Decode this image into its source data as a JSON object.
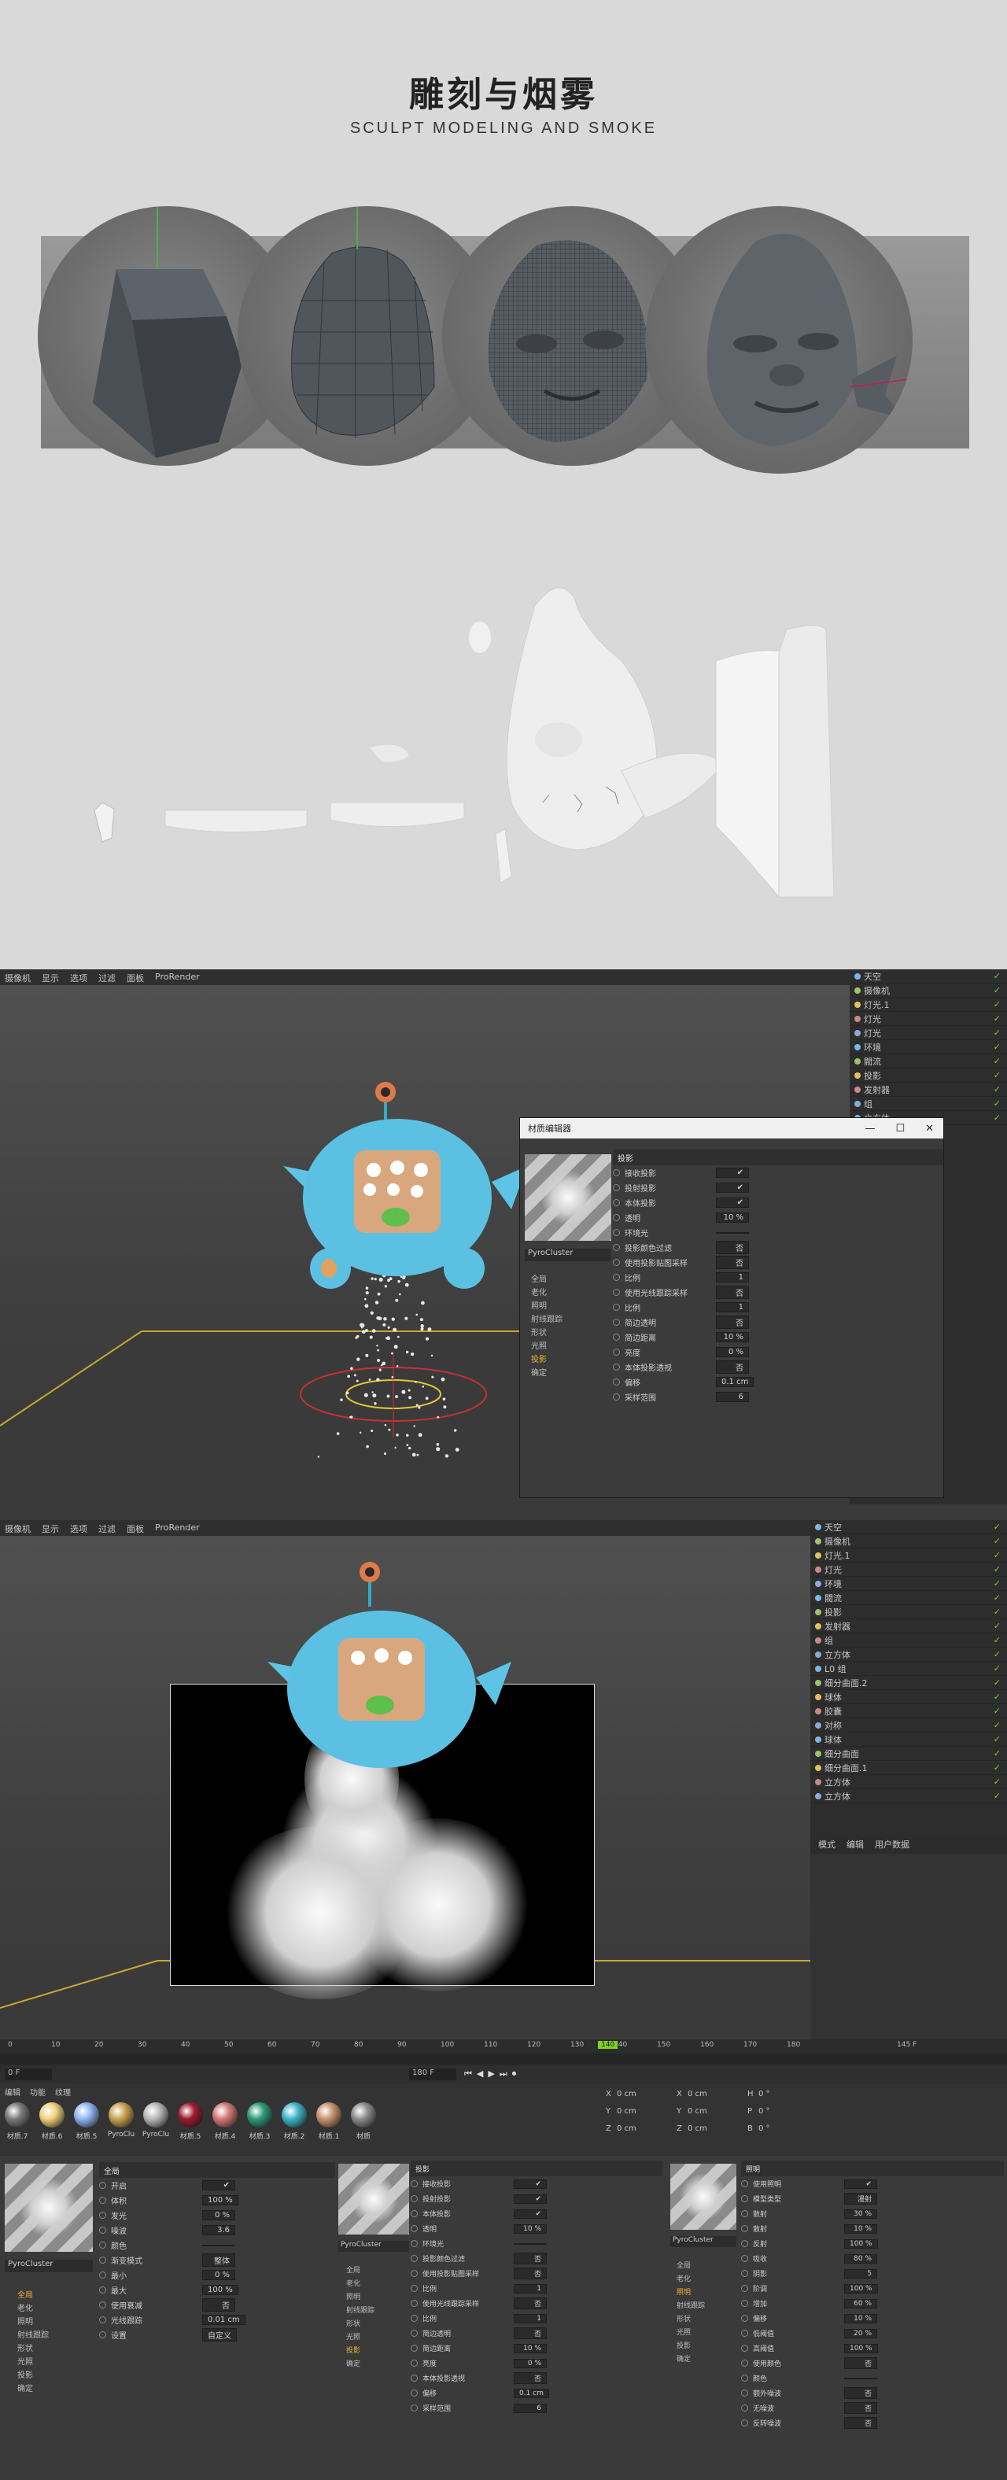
{
  "header": {
    "title": "雕刻与烟雾",
    "subtitle": "SCULPT MODELING AND SMOKE"
  },
  "menubar": [
    "摄像机",
    "显示",
    "选项",
    "过滤",
    "面板",
    "ProRender"
  ],
  "objects_top": [
    "天空",
    "摄像机",
    "灯光.1",
    "灯光",
    "灯光",
    "环境",
    "閥流",
    "投影",
    "发射器",
    "组",
    "立方体"
  ],
  "objects_mid": [
    "天空",
    "摄像机",
    "灯光.1",
    "灯光",
    "环境",
    "閥流",
    "投影",
    "发射器",
    "组",
    "立方体",
    "L0 组",
    "细分曲面.2",
    "球体",
    "胶囊",
    "对称",
    "球体",
    "细分曲面",
    "细分曲面.1",
    "立方体",
    "立方体"
  ],
  "mat_editor": {
    "title": "材质编辑器",
    "material_name": "PyroCluster",
    "channels": [
      "全局",
      "老化",
      "照明",
      "射线跟踪",
      "形状",
      "光照",
      "投影",
      "确定"
    ],
    "active_channel": "投影",
    "section": "投影",
    "rows": [
      {
        "label": "接收投影",
        "val": "✔"
      },
      {
        "label": "投射投影",
        "val": "✔"
      },
      {
        "label": "本体投影",
        "val": "✔"
      },
      {
        "label": "透明",
        "val": "10 %"
      },
      {
        "label": "环境光",
        "val": ""
      },
      {
        "label": "投影颜色过滤",
        "val": "否"
      },
      {
        "label": "使用投影贴图采样",
        "val": "否"
      },
      {
        "label": "比例",
        "val": "1"
      },
      {
        "label": "使用光线跟踪采样",
        "val": "否"
      },
      {
        "label": "比例",
        "val": "1"
      },
      {
        "label": "简边透明",
        "val": "否"
      },
      {
        "label": "简边距离",
        "val": "10 %"
      },
      {
        "label": "亮度",
        "val": "0 %"
      },
      {
        "label": "本体投影透视",
        "val": "否"
      },
      {
        "label": "偏移",
        "val": "0.1 cm"
      },
      {
        "label": "采样范围",
        "val": "6"
      }
    ]
  },
  "attr_tabs": [
    "模式",
    "编辑",
    "用户数据"
  ],
  "timeline": {
    "ticks": [
      "0",
      "10",
      "20",
      "30",
      "40",
      "50",
      "60",
      "70",
      "80",
      "90",
      "100",
      "110",
      "120",
      "130",
      "140",
      "150",
      "160",
      "170",
      "180"
    ],
    "frame_field": "0 F",
    "end_field": "180 F",
    "current": "140",
    "fps_label": "145 F"
  },
  "mat_menu": [
    "编辑",
    "功能",
    "纹理"
  ],
  "materials": [
    {
      "name": "材质.7",
      "color": "#7b7b7b"
    },
    {
      "name": "材质.6",
      "color": "#f0d27a"
    },
    {
      "name": "材质.5",
      "color": "#8fb7f2"
    },
    {
      "name": "PyroClu",
      "color": "#c9a44e"
    },
    {
      "name": "PyroClu",
      "color": "#b9b9b9"
    },
    {
      "name": "材质.5",
      "color": "#9c1b2e"
    },
    {
      "name": "材质.4",
      "color": "#d47b79"
    },
    {
      "name": "材质.3",
      "color": "#2f9a7a"
    },
    {
      "name": "材质.2",
      "color": "#40b6c9"
    },
    {
      "name": "材质.1",
      "color": "#c9956e"
    },
    {
      "name": "材质",
      "color": "#8e8e8e"
    }
  ],
  "coords": {
    "rows": [
      [
        "X",
        "0 cm",
        "X",
        "0 cm",
        "H",
        "0 °"
      ],
      [
        "Y",
        "0 cm",
        "Y",
        "0 cm",
        "P",
        "0 °"
      ],
      [
        "Z",
        "0 cm",
        "Z",
        "0 cm",
        "B",
        "0 °"
      ]
    ]
  },
  "panel1": {
    "name": "PyroCluster",
    "channels": [
      "全局",
      "老化",
      "照明",
      "射线跟踪",
      "形状",
      "光照",
      "投影",
      "确定"
    ],
    "section": "全局",
    "rows": [
      {
        "label": "开启",
        "val": "✔"
      },
      {
        "label": "体积",
        "val": "100 %"
      },
      {
        "label": "发光",
        "val": "0 %"
      },
      {
        "label": "噪波",
        "val": "3.6"
      },
      {
        "label": "颜色",
        "val": ""
      },
      {
        "label": "渐变模式",
        "val": "整体"
      },
      {
        "label": "最小",
        "val": "0 %"
      },
      {
        "label": "最大",
        "val": "100 %"
      },
      {
        "label": "使用衰减",
        "val": "否"
      },
      {
        "label": "光线跟踪",
        "val": "0.01 cm"
      },
      {
        "label": "设置",
        "val": "自定义"
      }
    ]
  },
  "panel2": {
    "name": "PyroCluster",
    "channels": [
      "全局",
      "老化",
      "照明",
      "射线跟踪",
      "形状",
      "光照",
      "投影",
      "确定"
    ]
  },
  "panel3": {
    "name": "PyroCluster",
    "channels": [
      "全局",
      "老化",
      "照明",
      "射线跟踪",
      "形状",
      "光照",
      "投影",
      "确定"
    ],
    "section": "照明",
    "rows": [
      {
        "label": "使用照明",
        "val": "✔"
      },
      {
        "label": "模型类型",
        "val": "漫射"
      },
      {
        "label": "散射",
        "val": "30 %"
      },
      {
        "label": "散射",
        "val": "10 %"
      },
      {
        "label": "反射",
        "val": "100 %"
      },
      {
        "label": "吸收",
        "val": "80 %"
      },
      {
        "label": "阴影",
        "val": "5"
      },
      {
        "label": "阶调",
        "val": "100 %"
      },
      {
        "label": "增加",
        "val": "60 %"
      },
      {
        "label": "偏移",
        "val": "10 %"
      },
      {
        "label": "低阈值",
        "val": "20 %"
      },
      {
        "label": "高阈值",
        "val": "100 %"
      },
      {
        "label": "使用颜色",
        "val": "否"
      },
      {
        "label": "颜色",
        "val": ""
      },
      {
        "label": "额外噪波",
        "val": "否"
      },
      {
        "label": "无噪波",
        "val": "否"
      },
      {
        "label": "反转噪波",
        "val": "否"
      }
    ]
  }
}
